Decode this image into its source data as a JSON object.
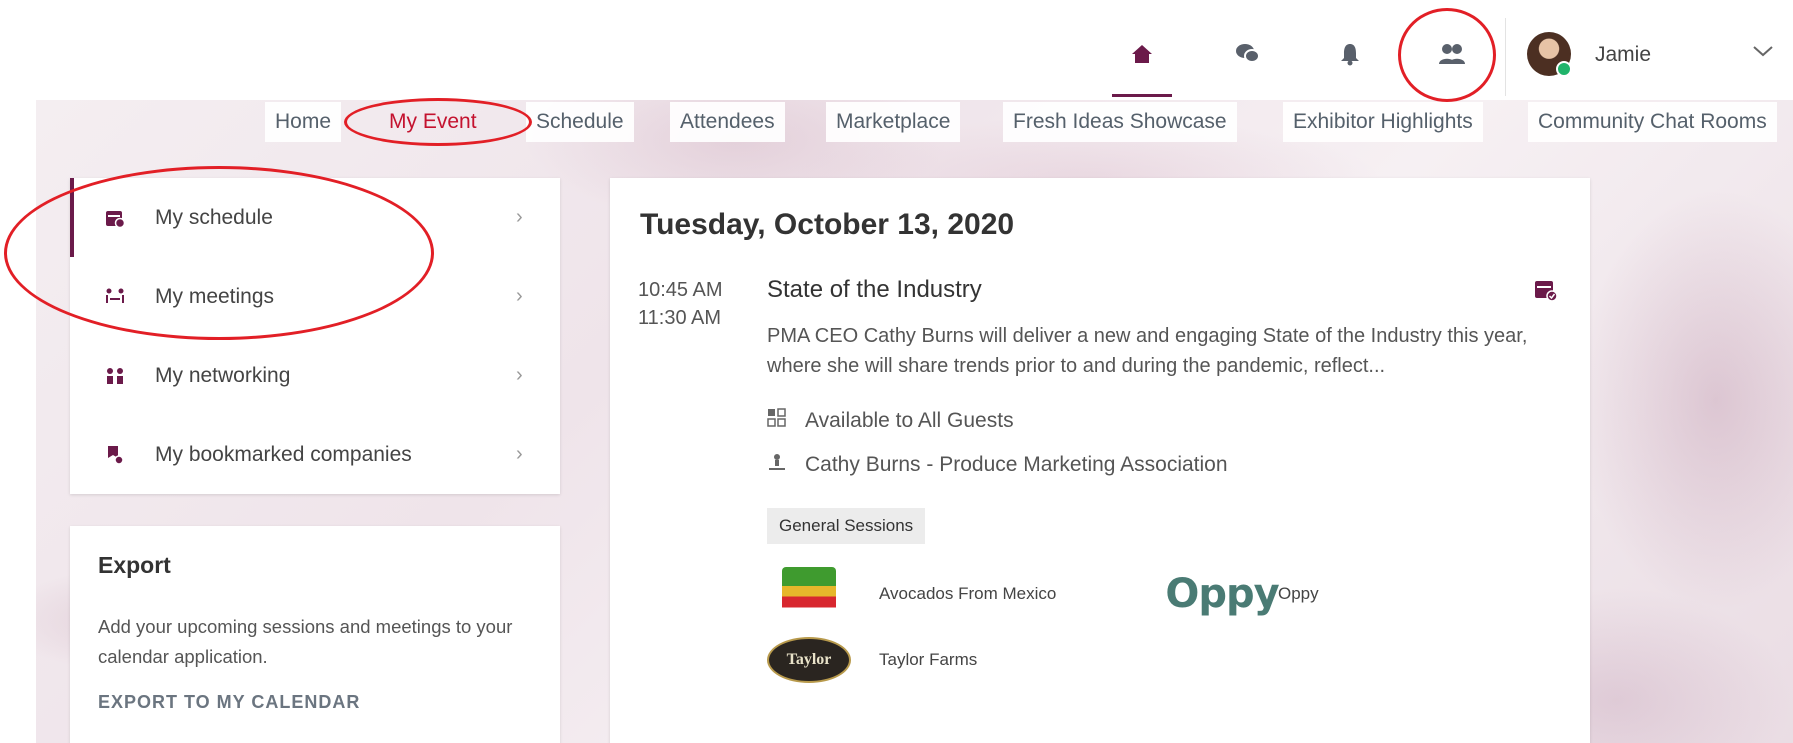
{
  "topbar": {
    "icons": [
      "home-icon",
      "chat-icon",
      "bell-icon",
      "people-icon"
    ],
    "user_name": "Jamie"
  },
  "nav": {
    "tabs": [
      "Home",
      "My Event",
      "Schedule",
      "Attendees",
      "Marketplace",
      "Fresh Ideas Showcase",
      "Exhibitor Highlights",
      "Community Chat Rooms"
    ],
    "active": "My Event"
  },
  "menu": {
    "items": [
      {
        "label": "My schedule",
        "icon": "calendar-icon",
        "active": true
      },
      {
        "label": "My meetings",
        "icon": "meeting-icon",
        "active": false
      },
      {
        "label": "My networking",
        "icon": "network-icon",
        "active": false
      },
      {
        "label": "My bookmarked companies",
        "icon": "bookmark-company-icon",
        "active": false
      }
    ]
  },
  "export": {
    "title": "Export",
    "description": "Add your upcoming sessions and meetings to your calendar application.",
    "link": "EXPORT TO MY CALENDAR"
  },
  "session": {
    "date": "Tuesday, October 13, 2020",
    "start_time": "10:45 AM",
    "end_time": "11:30 AM",
    "title": "State of the Industry",
    "description": "PMA CEO Cathy Burns will deliver a new and engaging State of the Industry this year, where she will share trends prior to and during the pandemic, reflect...",
    "availability": "Available to All Guests",
    "speaker": "Cathy Burns - Produce Marketing Association",
    "tag": "General Sessions",
    "sponsors": [
      {
        "name": "Avocados From Mexico"
      },
      {
        "name": "Oppy",
        "logo_text": "Oppy"
      },
      {
        "name": "Taylor Farms",
        "logo_text": "Taylor"
      }
    ]
  },
  "colors": {
    "brand": "#6b1a4a",
    "active_tab": "#c4122f",
    "annotation": "#e21f26",
    "online": "#20b46b"
  }
}
